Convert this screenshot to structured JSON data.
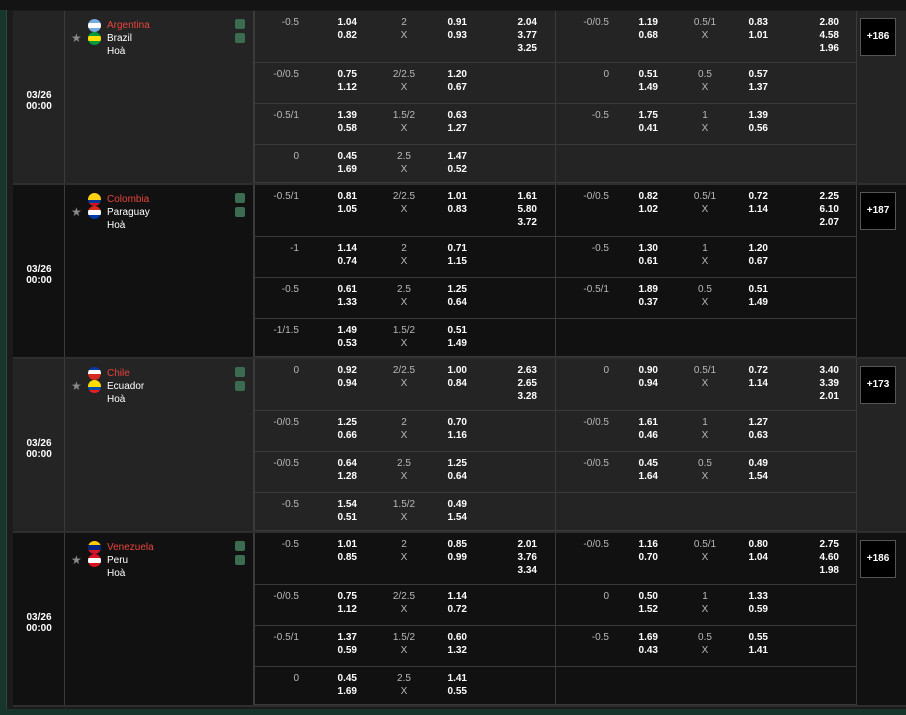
{
  "matches": [
    {
      "date": "03/26",
      "time": "00:00",
      "bg": "dark",
      "home": "Argentina",
      "away": "Brazil",
      "draw": "Hoà",
      "home_flag": "argentina-flag",
      "away_flag": "brazil-flag",
      "more": "+186",
      "rows": [
        {
          "l1": "-0.5",
          "h1": "1.04",
          "a1": "0.82",
          "g1": "2",
          "u1": "X",
          "o1": "0.91",
          "o2": "0.93",
          "x1": "2.04",
          "x2": "3.77",
          "x3": "3.25",
          "l2": "-0/0.5",
          "h2": "1.19",
          "a2": "0.68",
          "g2": "0.5/1",
          "u2": "X",
          "p1": "0.83",
          "p2": "1.01",
          "y1": "2.80",
          "y2": "4.58",
          "y3": "1.96"
        },
        {
          "l1": "-0/0.5",
          "h1": "0.75",
          "a1": "1.12",
          "g1": "2/2.5",
          "u1": "X",
          "o1": "1.20",
          "o2": "0.67",
          "l2": "0",
          "h2": "0.51",
          "a2": "1.49",
          "g2": "0.5",
          "u2": "X",
          "p1": "0.57",
          "p2": "1.37"
        },
        {
          "l1": "-0.5/1",
          "h1": "1.39",
          "a1": "0.58",
          "g1": "1.5/2",
          "u1": "X",
          "o1": "0.63",
          "o2": "1.27",
          "l2": "-0.5",
          "h2": "1.75",
          "a2": "0.41",
          "g2": "1",
          "u2": "X",
          "p1": "1.39",
          "p2": "0.56"
        },
        {
          "l1": "0",
          "h1": "0.45",
          "a1": "1.69",
          "g1": "2.5",
          "u1": "X",
          "o1": "1.47",
          "o2": "0.52"
        }
      ]
    },
    {
      "date": "03/26",
      "time": "00:00",
      "bg": "alt",
      "home": "Colombia",
      "away": "Paraguay",
      "draw": "Hoà",
      "home_flag": "colombia-flag",
      "away_flag": "paraguay-flag",
      "more": "+187",
      "rows": [
        {
          "l1": "-0.5/1",
          "h1": "0.81",
          "a1": "1.05",
          "g1": "2/2.5",
          "u1": "X",
          "o1": "1.01",
          "o2": "0.83",
          "x1": "1.61",
          "x2": "5.80",
          "x3": "3.72",
          "l2": "-0/0.5",
          "h2": "0.82",
          "a2": "1.02",
          "g2": "0.5/1",
          "u2": "X",
          "p1": "0.72",
          "p2": "1.14",
          "y1": "2.25",
          "y2": "6.10",
          "y3": "2.07"
        },
        {
          "l1": "-1",
          "h1": "1.14",
          "a1": "0.74",
          "g1": "2",
          "u1": "X",
          "o1": "0.71",
          "o2": "1.15",
          "l2": "-0.5",
          "h2": "1.30",
          "a2": "0.61",
          "g2": "1",
          "u2": "X",
          "p1": "1.20",
          "p2": "0.67"
        },
        {
          "l1": "-0.5",
          "h1": "0.61",
          "a1": "1.33",
          "g1": "2.5",
          "u1": "X",
          "o1": "1.25",
          "o2": "0.64",
          "l2": "-0.5/1",
          "h2": "1.89",
          "a2": "0.37",
          "g2": "0.5",
          "u2": "X",
          "p1": "0.51",
          "p2": "1.49"
        },
        {
          "l1": "-1/1.5",
          "h1": "1.49",
          "a1": "0.53",
          "g1": "1.5/2",
          "u1": "X",
          "o1": "0.51",
          "o2": "1.49"
        }
      ]
    },
    {
      "date": "03/26",
      "time": "00:00",
      "bg": "dark",
      "home": "Chile",
      "away": "Ecuador",
      "draw": "Hoà",
      "home_flag": "chile-flag",
      "away_flag": "ecuador-flag",
      "more": "+173",
      "rows": [
        {
          "l1": "0",
          "h1": "0.92",
          "a1": "0.94",
          "g1": "2/2.5",
          "u1": "X",
          "o1": "1.00",
          "o2": "0.84",
          "x1": "2.63",
          "x2": "2.65",
          "x3": "3.28",
          "l2": "0",
          "h2": "0.90",
          "a2": "0.94",
          "g2": "0.5/1",
          "u2": "X",
          "p1": "0.72",
          "p2": "1.14",
          "y1": "3.40",
          "y2": "3.39",
          "y3": "2.01"
        },
        {
          "l1": "-0/0.5",
          "h1": "1.25",
          "a1": "0.66",
          "g1": "2",
          "u1": "X",
          "o1": "0.70",
          "o2": "1.16",
          "l2": "-0/0.5",
          "h2": "1.61",
          "a2": "0.46",
          "g2": "1",
          "u2": "X",
          "p1": "1.27",
          "p2": "0.63"
        },
        {
          "l1": "-0/0.5",
          "h1": "0.64",
          "a1": "1.28",
          "g1": "2.5",
          "u1": "X",
          "o1": "1.25",
          "o2": "0.64",
          "l2": "-0/0.5",
          "h2": "0.45",
          "a2": "1.64",
          "g2": "0.5",
          "u2": "X",
          "p1": "0.49",
          "p2": "1.54"
        },
        {
          "l1": "-0.5",
          "h1": "1.54",
          "a1": "0.51",
          "g1": "1.5/2",
          "u1": "X",
          "o1": "0.49",
          "o2": "1.54"
        }
      ]
    },
    {
      "date": "03/26",
      "time": "00:00",
      "bg": "alt",
      "home": "Venezuela",
      "away": "Peru",
      "draw": "Hoà",
      "home_flag": "venezuela-flag",
      "away_flag": "peru-flag",
      "more": "+186",
      "rows": [
        {
          "l1": "-0.5",
          "h1": "1.01",
          "a1": "0.85",
          "g1": "2",
          "u1": "X",
          "o1": "0.85",
          "o2": "0.99",
          "x1": "2.01",
          "x2": "3.76",
          "x3": "3.34",
          "l2": "-0/0.5",
          "h2": "1.16",
          "a2": "0.70",
          "g2": "0.5/1",
          "u2": "X",
          "p1": "0.80",
          "p2": "1.04",
          "y1": "2.75",
          "y2": "4.60",
          "y3": "1.98"
        },
        {
          "l1": "-0/0.5",
          "h1": "0.75",
          "a1": "1.12",
          "g1": "2/2.5",
          "u1": "X",
          "o1": "1.14",
          "o2": "0.72",
          "l2": "0",
          "h2": "0.50",
          "a2": "1.52",
          "g2": "1",
          "u2": "X",
          "p1": "1.33",
          "p2": "0.59"
        },
        {
          "l1": "-0.5/1",
          "h1": "1.37",
          "a1": "0.59",
          "g1": "1.5/2",
          "u1": "X",
          "o1": "0.60",
          "o2": "1.32",
          "l2": "-0.5",
          "h2": "1.69",
          "a2": "0.43",
          "g2": "0.5",
          "u2": "X",
          "p1": "0.55",
          "p2": "1.41"
        },
        {
          "l1": "0",
          "h1": "0.45",
          "a1": "1.69",
          "g1": "2.5",
          "u1": "X",
          "o1": "1.41",
          "o2": "0.55"
        }
      ]
    }
  ],
  "colors": {
    "home_team": "#e8453c",
    "accent_green": "#17352a",
    "more_bg": "#000000"
  }
}
